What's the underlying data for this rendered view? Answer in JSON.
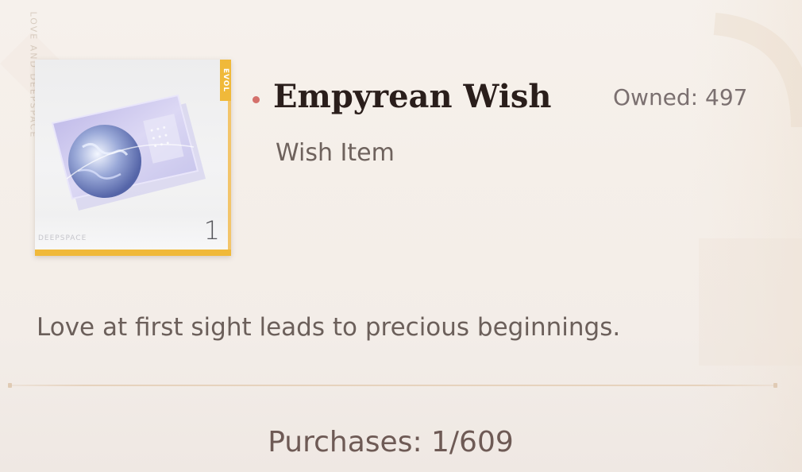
{
  "side_text": "LOVE AND DEEPSPACE",
  "item": {
    "rarity_tag": "EVOL",
    "brand": "DEEPSPACE",
    "count": "1",
    "title": "Empyrean Wish",
    "type": "Wish Item",
    "owned": "Owned: 497",
    "description": "Love at first sight leads to precious beginnings."
  },
  "purchases": "Purchases: 1/609",
  "icons": {
    "item": "planet-ticket-icon",
    "title_marker": "dot-icon"
  },
  "colors": {
    "accent_gold": "#f0b93a",
    "dot_red": "#d4706b",
    "title_dark": "#2a1e1b",
    "text_brown": "#6b5f5a"
  }
}
